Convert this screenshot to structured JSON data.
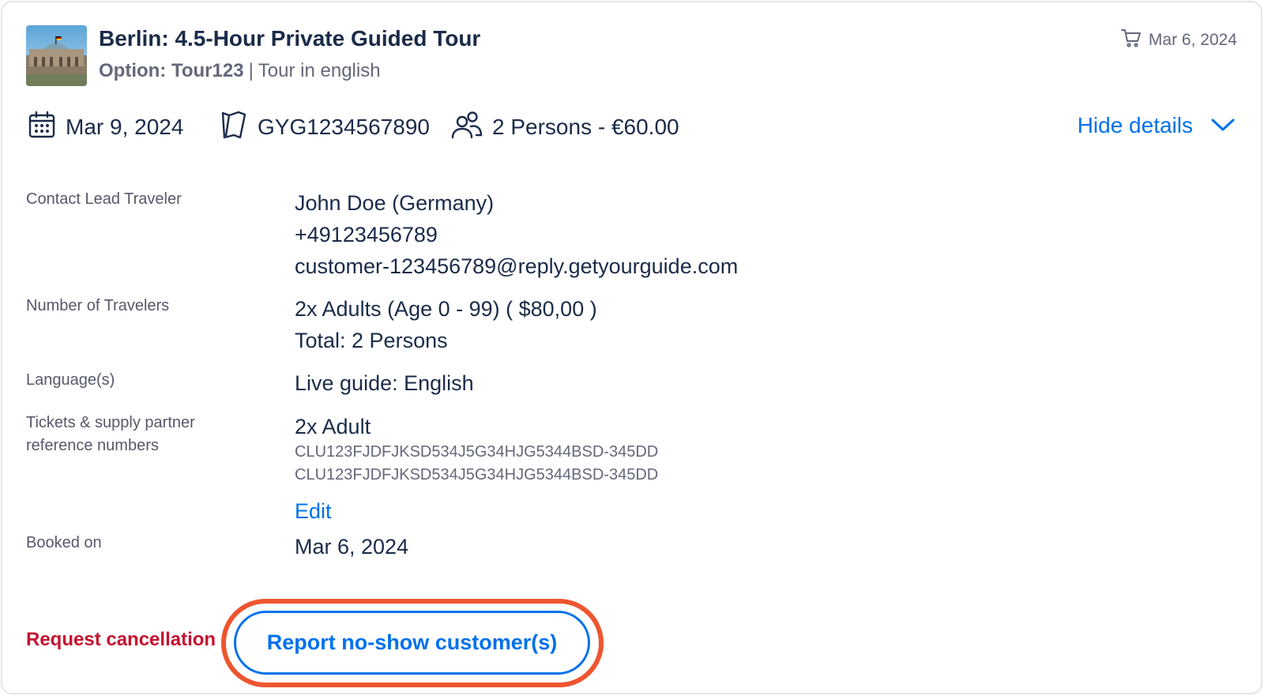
{
  "header": {
    "title": "Berlin: 4.5-Hour Private Guided Tour",
    "option_label": "Option: Tour123",
    "separator": "|",
    "option_detail": "Tour in english",
    "booked_date": "Mar 6, 2024"
  },
  "meta": {
    "date": "Mar 9, 2024",
    "reference": "GYG1234567890",
    "participants": "2 Persons - €60.00",
    "hide_details": "Hide details"
  },
  "details": {
    "contact": {
      "label": "Contact Lead Traveler",
      "name": "John Doe (Germany)",
      "phone": "+49123456789",
      "email": "customer-123456789@reply.getyourguide.com"
    },
    "travelers": {
      "label": "Number of Travelers",
      "line1": "2x Adults (Age 0 - 99) ( $80,00 )",
      "line2": "Total: 2 Persons"
    },
    "language": {
      "label": "Language(s)",
      "value": "Live guide: English"
    },
    "tickets": {
      "label_line1": "Tickets & supply partner",
      "label_line2": "reference numbers",
      "value": "2x Adult",
      "refs": [
        "CLU123FJDFJKSD534J5G34HJG5344BSD-345DD",
        "CLU123FJDFJKSD534J5G34HJG5344BSD-345DD"
      ],
      "edit": "Edit"
    },
    "booked": {
      "label": "Booked on",
      "value": "Mar 6, 2024"
    }
  },
  "actions": {
    "cancel": "Request cancellation",
    "no_show": "Report no-show customer(s)"
  },
  "colors": {
    "accent": "#0071eb",
    "danger": "#c5122f",
    "highlight": "#ee5530",
    "text": "#1a2b49",
    "muted": "#63687a"
  },
  "icons": {
    "thumbnail": "reichstag-thumbnail",
    "cart": "cart-icon",
    "date": "calendar-icon",
    "reference": "ticket-icon",
    "participants": "people-icon",
    "toggle": "chevron-down-icon"
  }
}
